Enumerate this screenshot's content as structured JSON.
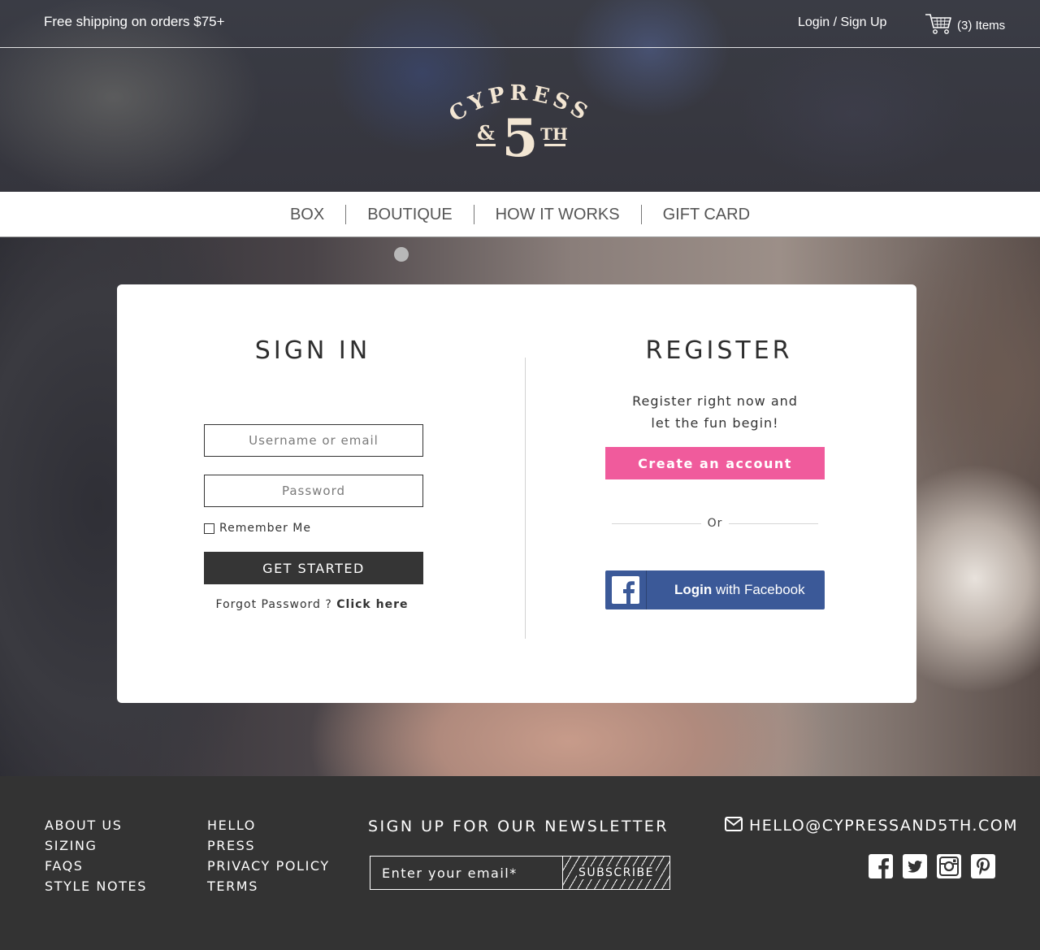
{
  "topbar": {
    "promo": "Free shipping on orders $75+",
    "login_link": "Login / Sign Up",
    "cart_label": "(3) Items"
  },
  "logo": {
    "word": "CYPRESS",
    "amp": "&",
    "number": "5",
    "suffix": "TH"
  },
  "nav": {
    "items": [
      "BOX",
      "BOUTIQUE",
      "HOW IT WORKS",
      "GIFT CARD"
    ]
  },
  "signin": {
    "title": "SIGN IN",
    "username_placeholder": "Username or email",
    "password_placeholder": "Password",
    "remember_label": "Remember Me",
    "submit_label": "GET STARTED",
    "forgot_text": "Forgot Password ? ",
    "forgot_link": "Click here"
  },
  "register": {
    "title": "REGISTER",
    "text_line1": "Register right now and",
    "text_line2": "let the fun begin!",
    "create_label": "Create an account",
    "or_label": "Or",
    "fb_prefix": "Login",
    "fb_suffix": " with Facebook"
  },
  "footer": {
    "col1": [
      "ABOUT US",
      "SIZING",
      "FAQS",
      "STYLE NOTES"
    ],
    "col2": [
      "HELLO",
      "PRESS",
      "PRIVACY POLICY",
      "TERMS"
    ],
    "newsletter_title": "SIGN UP FOR OUR NEWSLETTER",
    "newsletter_placeholder": "Enter your email*",
    "subscribe_label": "SUBSCRIBE",
    "email": "HELLO@CYPRESSAND5TH.COM",
    "social_icons": [
      "facebook-icon",
      "twitter-icon",
      "instagram-icon",
      "pinterest-icon"
    ]
  },
  "colors": {
    "accent_pink": "#f05b9c",
    "facebook_blue": "#3b5998",
    "dark": "#333333",
    "logo_cream": "#f3e6d3"
  }
}
